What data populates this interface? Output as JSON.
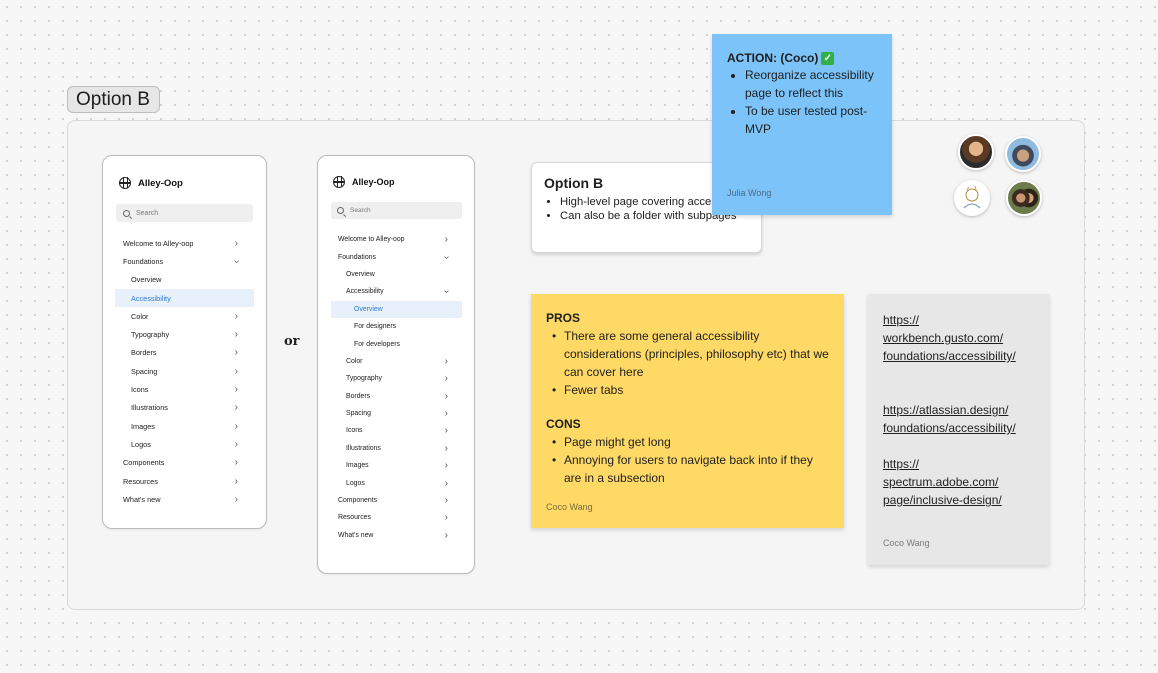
{
  "section": {
    "label": "Option B"
  },
  "phone_a": {
    "brand": "Alley-Oop",
    "search_placeholder": "Search",
    "items": [
      {
        "label": "Welcome to Alley-oop",
        "chev": "›"
      },
      {
        "label": "Foundations",
        "chev": "›"
      },
      {
        "label": "Overview",
        "chev": ""
      },
      {
        "label": "Accessibility",
        "chev": ""
      },
      {
        "label": "Color",
        "chev": "›"
      },
      {
        "label": "Typography",
        "chev": "›"
      },
      {
        "label": "Borders",
        "chev": "›"
      },
      {
        "label": "Spacing",
        "chev": "›"
      },
      {
        "label": "Icons",
        "chev": "›"
      },
      {
        "label": "Illustrations",
        "chev": "›"
      },
      {
        "label": "Images",
        "chev": "›"
      },
      {
        "label": "Logos",
        "chev": "›"
      },
      {
        "label": "Components",
        "chev": "›"
      },
      {
        "label": "Resources",
        "chev": "›"
      },
      {
        "label": "What's new",
        "chev": "›"
      }
    ]
  },
  "or_label": "or",
  "phone_b": {
    "brand": "Alley-Oop",
    "search_placeholder": "Search",
    "items": [
      {
        "label": "Welcome to Alley-oop",
        "chev": "›"
      },
      {
        "label": "Foundations",
        "chev": "›"
      },
      {
        "label": "Overview",
        "chev": ""
      },
      {
        "label": "Accessibility",
        "chev": "›"
      },
      {
        "label": "Overview",
        "chev": ""
      },
      {
        "label": "For designers",
        "chev": ""
      },
      {
        "label": "For developers",
        "chev": ""
      },
      {
        "label": "Color",
        "chev": "›"
      },
      {
        "label": "Typography",
        "chev": "›"
      },
      {
        "label": "Borders",
        "chev": "›"
      },
      {
        "label": "Spacing",
        "chev": "›"
      },
      {
        "label": "Icons",
        "chev": "›"
      },
      {
        "label": "Illustrations",
        "chev": "›"
      },
      {
        "label": "Images",
        "chev": "›"
      },
      {
        "label": "Logos",
        "chev": "›"
      },
      {
        "label": "Components",
        "chev": "›"
      },
      {
        "label": "Resources",
        "chev": "›"
      },
      {
        "label": "What's new",
        "chev": "›"
      }
    ]
  },
  "option_card": {
    "title": "Option B",
    "bullets": [
      "High-level page covering accessibility",
      "Can also be a folder with subpages"
    ]
  },
  "action_note": {
    "title": "ACTION: (Coco)",
    "check": "✓",
    "bullets": [
      "Reorganize accessibility page to reflect this",
      "To be user tested post-MVP"
    ],
    "author": "Julia Wong",
    "color": "#7bc3f9"
  },
  "pros_cons_note": {
    "pros_title": "PROS",
    "pros": [
      "There are some general accessibility considerations (principles, philosophy etc) that we can cover here",
      "Fewer tabs"
    ],
    "cons_title": "CONS",
    "cons": [
      "Page might get long",
      "Annoying for users to navigate back into if they are in a subsection"
    ],
    "author": "Coco Wang",
    "color": "#ffd966"
  },
  "links_note": {
    "links": [
      {
        "lines": [
          "https://",
          "workbench.gusto.com/",
          "foundations/accessibility/"
        ]
      },
      {
        "lines": [
          "https://atlassian.design/",
          "foundations/accessibility/"
        ]
      },
      {
        "lines": [
          "https://",
          "spectrum.adobe.com/",
          "page/inclusive-design/"
        ]
      }
    ],
    "author": "Coco Wang",
    "color": "#e7e7e7"
  },
  "avatars": [
    "avatar-1",
    "avatar-2",
    "avatar-3",
    "avatar-4"
  ]
}
